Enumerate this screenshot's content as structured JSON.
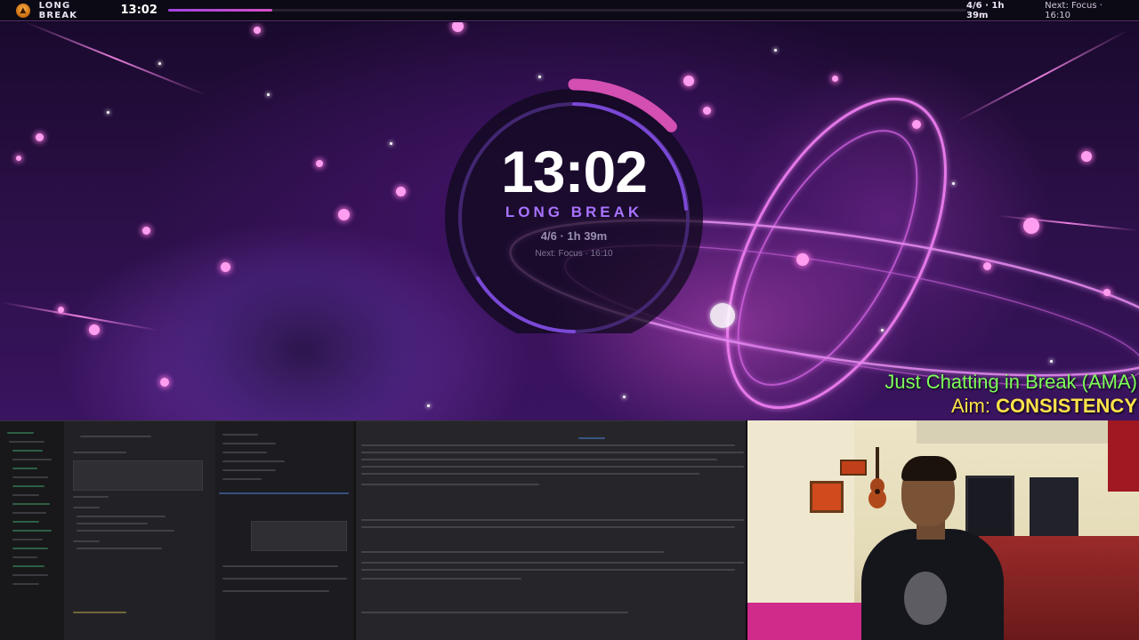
{
  "topbar": {
    "logo_icon": "flame-icon",
    "mode_label": "LONG BREAK",
    "time": "13:02",
    "progress_fraction": 0.13,
    "session": "4/6 · 1h 39m",
    "next": "Next: Focus · 16:10"
  },
  "timer": {
    "time": "13:02",
    "mode": "LONG BREAK",
    "session": "4/6 · 1h 39m",
    "next": "Next: Focus · 16:10",
    "ring_progress_fraction": 0.13,
    "accent_color": "#d44fb2",
    "mode_color": "#a873ff"
  },
  "overlay": {
    "title": "Just Chatting in Break (AMA)",
    "aim_label": "Aim: ",
    "aim_value": "CONSISTENCY",
    "title_color": "#7dff5a",
    "aim_color": "#ffe34a"
  }
}
